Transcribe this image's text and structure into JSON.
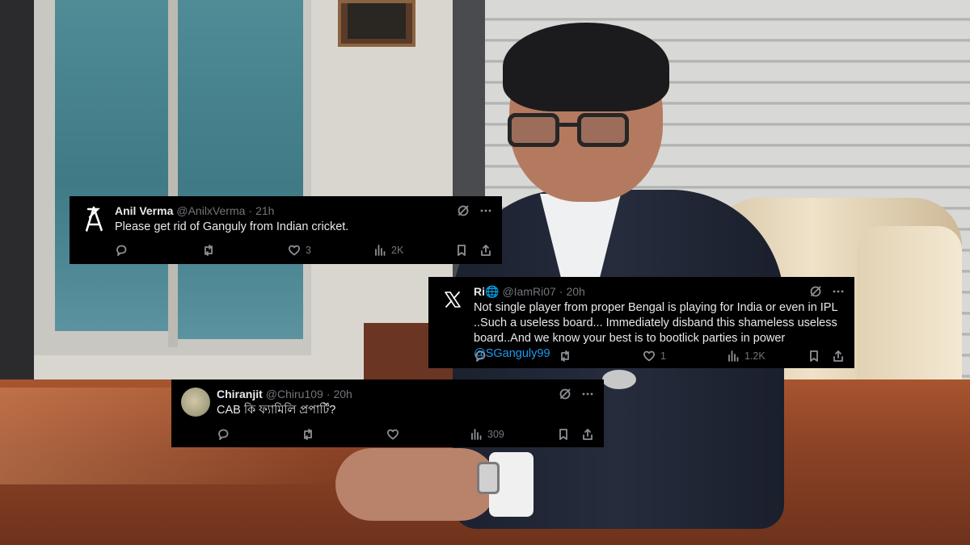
{
  "tweets": [
    {
      "name": "Anil Verma",
      "handle": "@AnilxVerma",
      "time": "21h",
      "text": "Please get rid of Ganguly from Indian cricket.",
      "mention": "",
      "likes": "3",
      "views": "2K",
      "avatar_icon": "stylized-A-logo-icon"
    },
    {
      "name": "Ri",
      "name_emoji": "🌐",
      "handle": "@IamRi07",
      "time": "20h",
      "text": "Not single player from proper Bengal is playing for India or even in IPL ..Such a useless board... Immediately disband this shameless useless board..And we know your best is to bootlick parties in power",
      "mention": "@SGanguly99",
      "likes": "1",
      "views": "1.2K",
      "avatar_icon": "x-logo-icon"
    },
    {
      "name": "Chiranjit",
      "handle": "@Chiru109",
      "time": "20h",
      "text": "CAB কি ফ্যামিলি প্রপার্টি?",
      "mention": "",
      "likes": "",
      "views": "309",
      "avatar_icon": "avatar-photo-icon"
    }
  ],
  "colors": {
    "card_bg": "#000000",
    "text": "#e7e9ea",
    "muted": "#71767b",
    "link": "#1d9bf0"
  }
}
